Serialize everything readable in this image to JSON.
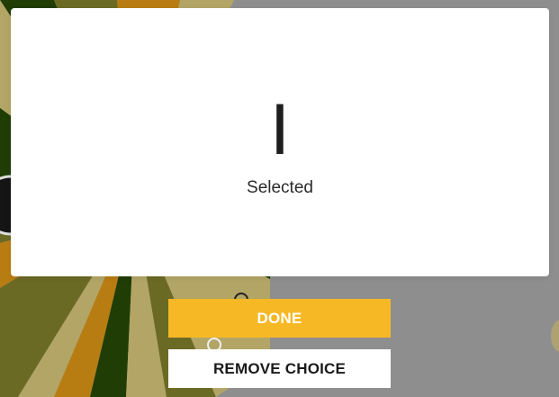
{
  "modal": {
    "result_value": "I",
    "result_label": "Selected"
  },
  "actions": {
    "done_label": "DONE",
    "remove_label": "REMOVE CHOICE"
  },
  "colors": {
    "backdrop": "#8e8e8e",
    "done_button": "#f7b825",
    "wheel_dark_green": "#1f3d05",
    "wheel_olive": "#6b6a24",
    "wheel_khaki": "#b3a566",
    "wheel_orange": "#b87d12"
  }
}
